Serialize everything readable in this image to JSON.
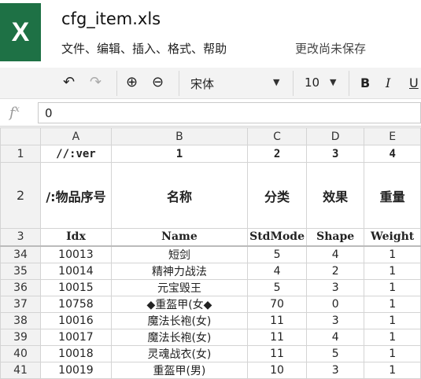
{
  "app": {
    "logo_letter": "X",
    "file_name": "cfg_item.xls",
    "save_status": "更改尚未保存"
  },
  "menus": [
    "文件、",
    "编辑、",
    "插入、",
    "格式、",
    "帮助"
  ],
  "toolbar": {
    "font": "宋体",
    "size": "10",
    "bold": "B",
    "italic": "I",
    "underline": "U"
  },
  "formula": {
    "label": "fx",
    "value": "0"
  },
  "columns": [
    "A",
    "B",
    "C",
    "D",
    "E"
  ],
  "rows": [
    {
      "num": "1",
      "cells": [
        "//:ver",
        "1",
        "2",
        "3",
        "4"
      ]
    },
    {
      "num": "2",
      "cells": [
        "/:物品序号",
        "名称",
        "分类",
        "效果",
        "重量"
      ]
    },
    {
      "num": "3",
      "cells": [
        "Idx",
        "Name",
        "StdMode",
        "Shape",
        "Weight"
      ]
    },
    {
      "num": "34",
      "cells": [
        "10013",
        "短剑",
        "5",
        "4",
        "1"
      ]
    },
    {
      "num": "35",
      "cells": [
        "10014",
        "精神力战法",
        "4",
        "2",
        "1"
      ]
    },
    {
      "num": "36",
      "cells": [
        "10015",
        "元宝毁王",
        "5",
        "3",
        "1"
      ]
    },
    {
      "num": "37",
      "cells": [
        "10758",
        "◆重盔甲(女◆",
        "70",
        "0",
        "1"
      ]
    },
    {
      "num": "38",
      "cells": [
        "10016",
        "魔法长袍(女)",
        "11",
        "3",
        "1"
      ]
    },
    {
      "num": "39",
      "cells": [
        "10017",
        "魔法长袍(女)",
        "11",
        "4",
        "1"
      ]
    },
    {
      "num": "40",
      "cells": [
        "10018",
        "灵魂战衣(女)",
        "11",
        "5",
        "1"
      ]
    },
    {
      "num": "41",
      "cells": [
        "10019",
        "重盔甲(男)",
        "10",
        "3",
        "1"
      ]
    }
  ]
}
